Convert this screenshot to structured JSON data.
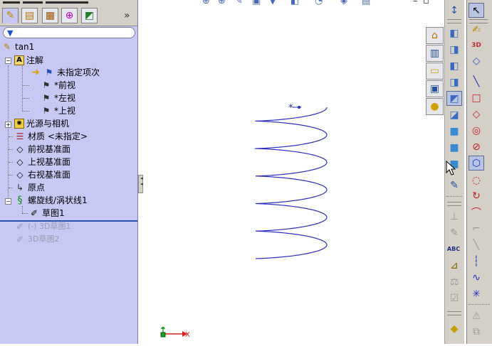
{
  "feature_tree": {
    "tabs": [
      {
        "name": "featuremanager-tab",
        "icon": "feature-tree-icon",
        "glyph": "✎"
      },
      {
        "name": "propertymanager-tab",
        "icon": "property-icon",
        "glyph": "▤"
      },
      {
        "name": "configuration-tab",
        "icon": "configuration-icon",
        "glyph": "▦"
      },
      {
        "name": "dimxpert-tab",
        "icon": "crosshair-icon",
        "glyph": "⊕"
      },
      {
        "name": "display-tab",
        "icon": "display-icon",
        "glyph": "◩"
      }
    ],
    "more_glyph": "»",
    "filter_glyph": "▼",
    "root": "tan1",
    "annotations": "注解",
    "undefined_items": "未指定项次",
    "front_view": "*前视",
    "left_view": "*左视",
    "top_view": "*上视",
    "lights_cameras": "光源与相机",
    "material": "材质 <未指定>",
    "front_plane": "前视基准面",
    "top_plane": "上视基准面",
    "right_plane": "右视基准面",
    "origin": "原点",
    "helix": "螺旋线/涡状线1",
    "sketch1": "草图1",
    "sketch3d_1": "(-) 3D草图1",
    "sketch3d_2": "3D草图2",
    "expand_minus": "−",
    "expand_plus": "+"
  },
  "splitter": {
    "glyph": "◂◂"
  },
  "graphics": {
    "helix_turns": 6,
    "start_marker": "*",
    "triad_x_label": "X"
  },
  "task_pane": {
    "tabs": [
      {
        "name": "home-tab",
        "icon": "home-icon",
        "glyph": "⌂"
      },
      {
        "name": "design-library-tab",
        "icon": "library-icon",
        "glyph": "▥"
      },
      {
        "name": "file-explorer-tab",
        "icon": "folder-icon",
        "glyph": "▭"
      },
      {
        "name": "view-palette-tab",
        "icon": "view-palette-icon",
        "glyph": "▣"
      },
      {
        "name": "appearances-tab",
        "icon": "appearance-ball-icon",
        "glyph": "●"
      }
    ]
  },
  "colors": {
    "tree_bg": "#c8c8f4",
    "helix": "#2c2cc0",
    "triad_x": "#e02020",
    "triad_y": "#20a020"
  }
}
